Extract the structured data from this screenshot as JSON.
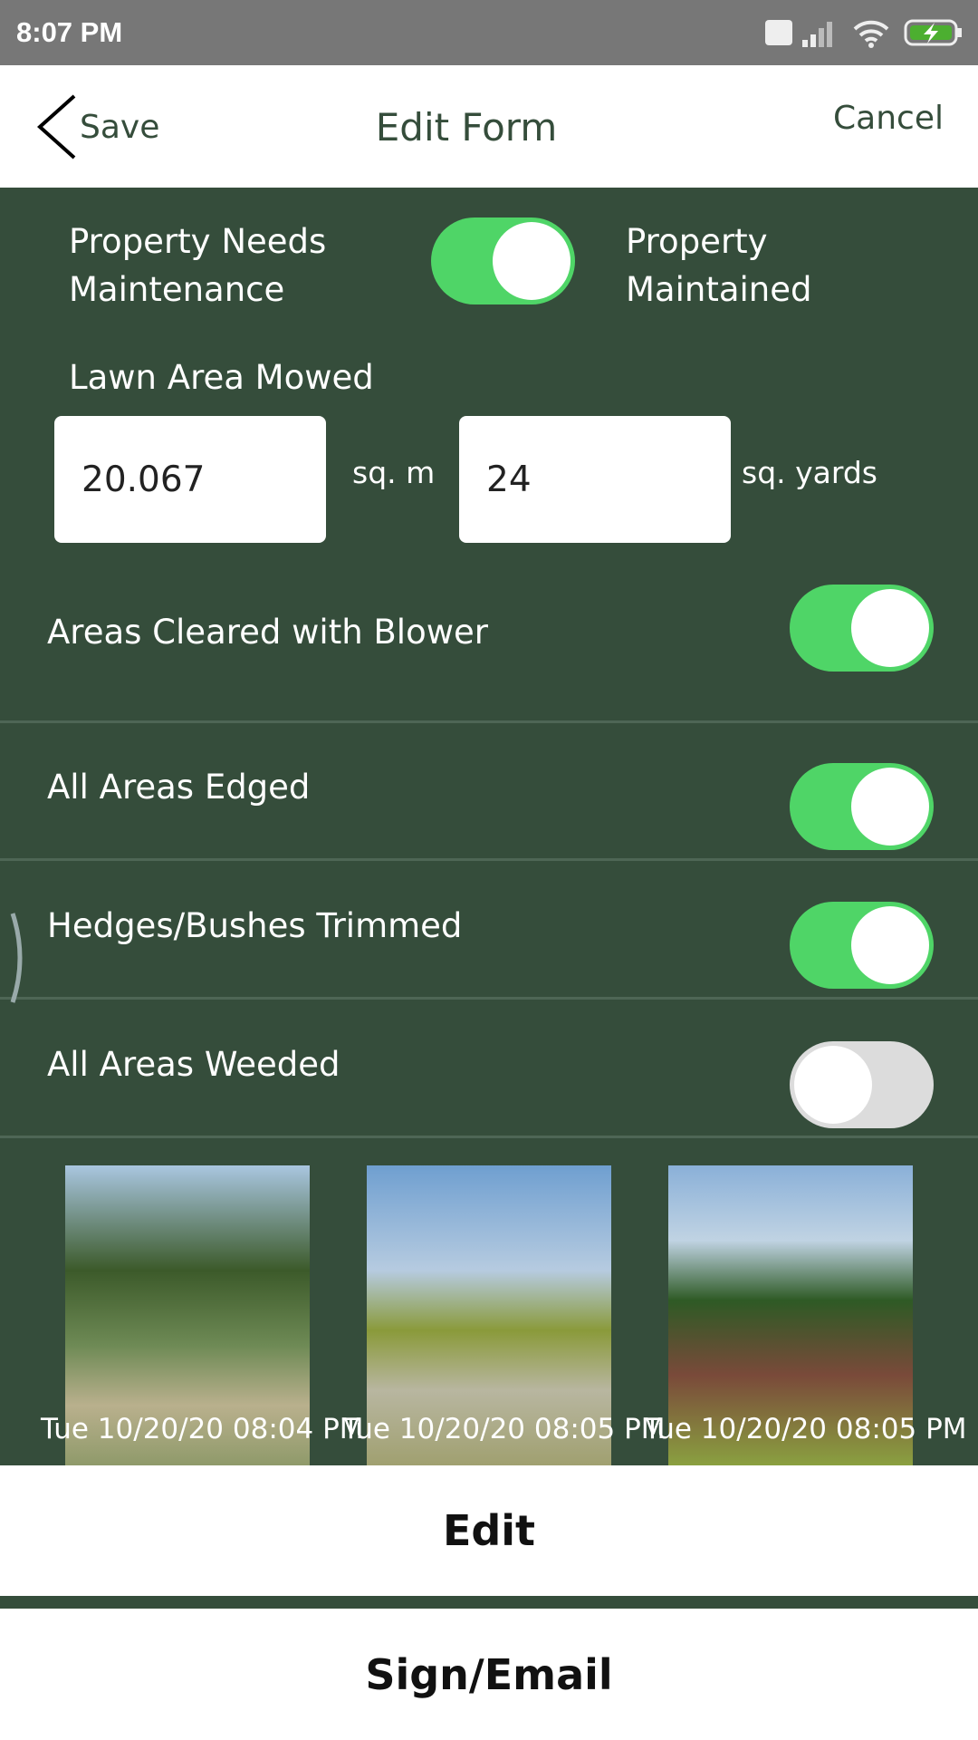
{
  "status_bar": {
    "time": "8:07 PM",
    "icons": [
      "volte-icon",
      "signal-icon",
      "wifi-icon",
      "battery-charging-icon"
    ]
  },
  "header": {
    "back_label": "Save",
    "title": "Edit Form",
    "cancel_label": "Cancel"
  },
  "maintenance": {
    "left_label": "Property Needs Maintenance",
    "right_label": "Property Maintained",
    "on": true
  },
  "lawn": {
    "label": "Lawn Area Mowed",
    "sqm_value": "20.067",
    "sqm_unit": "sq. m",
    "sqyd_value": "24",
    "sqyd_unit": "sq. yards"
  },
  "toggles": [
    {
      "label": "Areas Cleared with Blower",
      "on": true
    },
    {
      "label": "All Areas Edged",
      "on": true
    },
    {
      "label": "Hedges/Bushes Trimmed",
      "on": true
    },
    {
      "label": "All Areas Weeded",
      "on": false
    }
  ],
  "photos": [
    {
      "caption": "Tue 10/20/20 08:04 PM"
    },
    {
      "caption": "Tue 10/20/20 08:05 PM"
    },
    {
      "caption": "Tue 10/20/20 08:05 PM"
    }
  ],
  "actions": {
    "edit": "Edit",
    "sign_email": "Sign/Email"
  },
  "colors": {
    "background": "#354d3b",
    "toggle_on": "#4fd567",
    "toggle_off": "#dcdcdc"
  }
}
